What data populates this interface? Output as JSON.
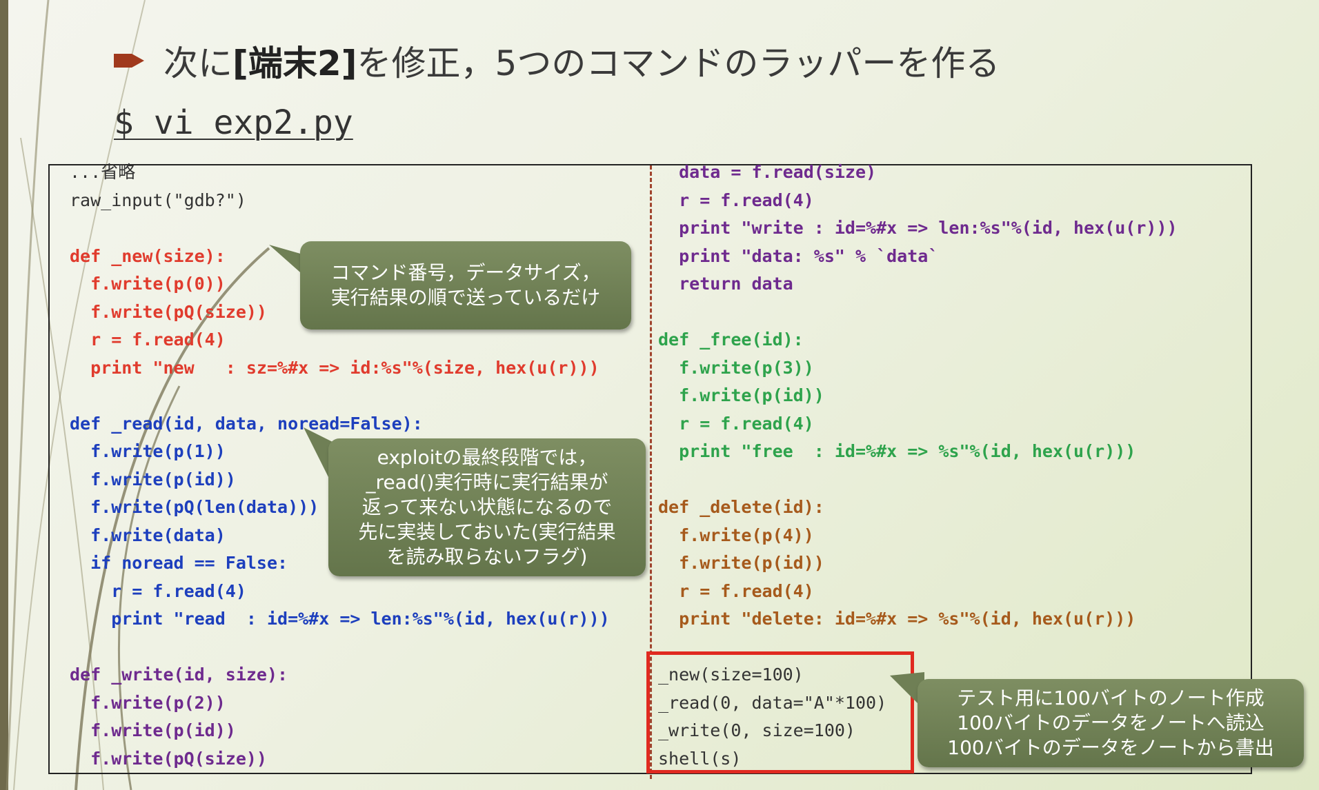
{
  "slide": {
    "heading_pre": "次に",
    "heading_bracket_open": "[",
    "heading_strong": "端末2",
    "heading_bracket_close": "]",
    "heading_post": "を修正，5つのコマンドのラッパーを作る",
    "command": "$ vi exp2.py"
  },
  "code_left": [
    "...省略",
    "raw_input(\"gdb?\")",
    "",
    "def _new(size):",
    "  f.write(p(0))",
    "  f.write(pQ(size))",
    "  r = f.read(4)",
    "  print \"new   : sz=%#x => id:%s\"%(size, hex(u(r)))",
    "",
    "def _read(id, data, noread=False):",
    "  f.write(p(1))",
    "  f.write(p(id))",
    "  f.write(pQ(len(data)))",
    "  f.write(data)",
    "  if noread == False:",
    "    r = f.read(4)",
    "    print \"read  : id=%#x => len:%s\"%(id, hex(u(r)))",
    "",
    "def _write(id, size):",
    "  f.write(p(2))",
    "  f.write(p(id))",
    "  f.write(pQ(size))"
  ],
  "code_right": [
    "  data = f.read(size)",
    "  r = f.read(4)",
    "  print \"write : id=%#x => len:%s\"%(id, hex(u(r)))",
    "  print \"data: %s\" % `data`",
    "  return data",
    "",
    "def _free(id):",
    "  f.write(p(3))",
    "  f.write(p(id))",
    "  r = f.read(4)",
    "  print \"free  : id=%#x => %s\"%(id, hex(u(r)))",
    "",
    "def _delete(id):",
    "  f.write(p(4))",
    "  f.write(p(id))",
    "  r = f.read(4)",
    "  print \"delete: id=%#x => %s\"%(id, hex(u(r)))",
    "",
    "_new(size=100)",
    "_read(0, data=\"A\"*100)",
    "_write(0, size=100)",
    "shell(s)"
  ],
  "callouts": {
    "c1": [
      "コマンド番号，データサイズ，",
      "実行結果の順で送っているだけ"
    ],
    "c2": [
      "exploitの最終段階では，",
      "_read()実行時に実行結果が",
      "返って来ない状態になるので",
      "先に実装しておいた(実行結果",
      "を読み取らないフラグ)"
    ],
    "c3": [
      "テスト用に100バイトのノート作成",
      "100バイトのデータをノートへ読込",
      "100バイトのデータをノートから書出"
    ]
  },
  "colors": {
    "red": "#e03b2d",
    "blue": "#1d3fbd",
    "purple": "#6e2a8e",
    "green": "#2ea34c",
    "brown": "#a65a1c",
    "highlight_box": "#e02a20",
    "callout": "#6f7f55"
  },
  "icons": {
    "bullet": "arrow-bullet-icon"
  }
}
